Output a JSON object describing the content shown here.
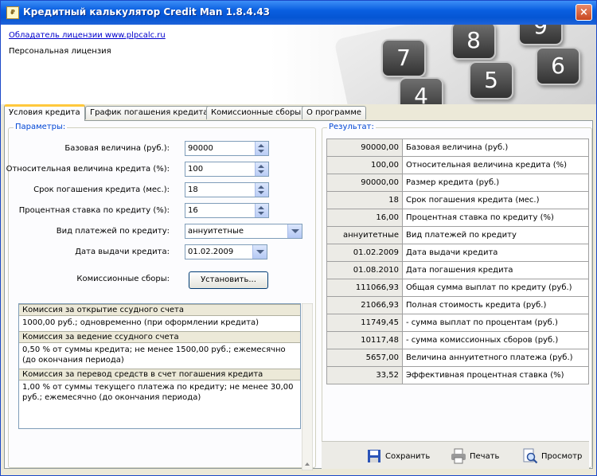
{
  "window": {
    "title": "Кредитный калькулятор Credit Man 1.8.4.43",
    "close_glyph": "×"
  },
  "header": {
    "owner_link": "Обладатель лицензии www.plpcalc.ru",
    "license_type": "Персональная лицензия",
    "calculator_keys": [
      "7",
      "8",
      "9",
      "4",
      "5",
      "6"
    ]
  },
  "tabs": [
    {
      "label": "Условия кредита",
      "active": true
    },
    {
      "label": "График погашения кредита",
      "active": false
    },
    {
      "label": "Комиссионные сборы",
      "active": false
    },
    {
      "label": "О программе",
      "active": false
    }
  ],
  "params": {
    "group_title": "Параметры:",
    "base_amount": {
      "label": "Базовая величина (руб.):",
      "value": "90000"
    },
    "relative_amount": {
      "label": "Относительная величина кредита (%):",
      "value": "100"
    },
    "term": {
      "label": "Срок погашения кредита (мес.):",
      "value": "18"
    },
    "rate": {
      "label": "Процентная ставка по кредиту (%):",
      "value": "16"
    },
    "payment_type": {
      "label": "Вид платежей по кредиту:",
      "value": "аннуитетные"
    },
    "issue_date": {
      "label": "Дата выдачи кредита:",
      "value": "01.02.2009"
    },
    "commissions": {
      "label": "Комиссионные сборы:",
      "button": "Установить..."
    }
  },
  "commission_list": [
    {
      "title": "Комиссия за открытие ссудного счета",
      "text": "1000,00 руб.; одновременно (при оформлении кредита)"
    },
    {
      "title": "Комиссия за ведение ссудного счета",
      "text": "0,50 % от суммы кредита; не менее 1500,00 руб.; ежемесячно (до окончания периода)"
    },
    {
      "title": "Комиссия за перевод средств в счет погашения кредита",
      "text": "1,00 % от суммы текущего платежа по кредиту; не менее 30,00 руб.; ежемесячно (до окончания периода)"
    }
  ],
  "results": {
    "group_title": "Результат:",
    "rows": [
      {
        "value": "90000,00",
        "label": "Базовая величина (руб.)"
      },
      {
        "value": "100,00",
        "label": "Относительная величина кредита (%)"
      },
      {
        "value": "90000,00",
        "label": "Размер кредита (руб.)"
      },
      {
        "value": "18",
        "label": "Срок погашения кредита (мес.)"
      },
      {
        "value": "16,00",
        "label": "Процентная ставка по кредиту (%)"
      },
      {
        "value": "аннуитетные",
        "label": "Вид платежей по кредиту"
      },
      {
        "value": "01.02.2009",
        "label": "Дата выдачи кредита"
      },
      {
        "value": "01.08.2010",
        "label": "Дата погашения кредита"
      },
      {
        "value": "111066,93",
        "label": "Общая сумма выплат по кредиту (руб.)"
      },
      {
        "value": "21066,93",
        "label": "Полная стоимость кредита (руб.)"
      },
      {
        "value": "11749,45",
        "label": "- сумма выплат по процентам (руб.)"
      },
      {
        "value": "10117,48",
        "label": "- сумма комиссионных сборов (руб.)"
      },
      {
        "value": "5657,00",
        "label": "Величина аннуитетного платежа (руб.)"
      },
      {
        "value": "33,52",
        "label": "Эффективная процентная ставка (%)"
      }
    ],
    "actions": {
      "save": "Сохранить",
      "print": "Печать",
      "preview": "Просмотр"
    }
  },
  "colors": {
    "titlebar": "#0556d4",
    "group_title": "#0046d5",
    "tab_highlight": "#ffc83c"
  }
}
